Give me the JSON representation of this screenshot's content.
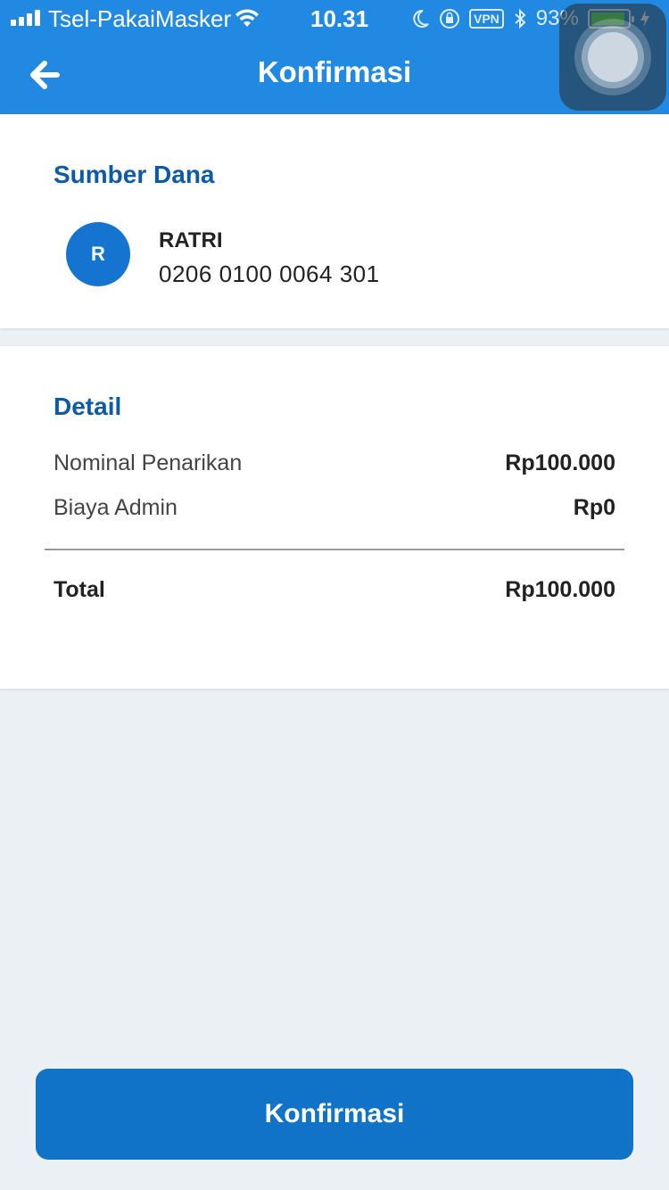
{
  "status_bar": {
    "carrier": "Tsel-PakaiMasker",
    "time": "10.31",
    "vpn_label": "VPN",
    "battery_percent": "93%",
    "battery_level": 0.93,
    "icons": [
      "signal-icon",
      "wifi-icon",
      "moon-icon",
      "rotation-lock-icon",
      "bluetooth-icon",
      "battery-icon",
      "charging-icon"
    ]
  },
  "header": {
    "title": "Konfirmasi",
    "back_icon": "arrow-left-icon",
    "color": "#2289e3"
  },
  "source_of_funds": {
    "title": "Sumber Dana",
    "avatar_initial": "R",
    "account_name": "RATRI",
    "account_number": "0206 0100 0064 301"
  },
  "detail": {
    "title": "Detail",
    "rows": [
      {
        "label": "Nominal Penarikan",
        "value": "Rp100.000"
      },
      {
        "label": "Biaya Admin",
        "value": "Rp0"
      }
    ],
    "total": {
      "label": "Total",
      "value": "Rp100.000"
    }
  },
  "confirm_button": {
    "label": "Konfirmasi",
    "color": "#1173c8"
  }
}
